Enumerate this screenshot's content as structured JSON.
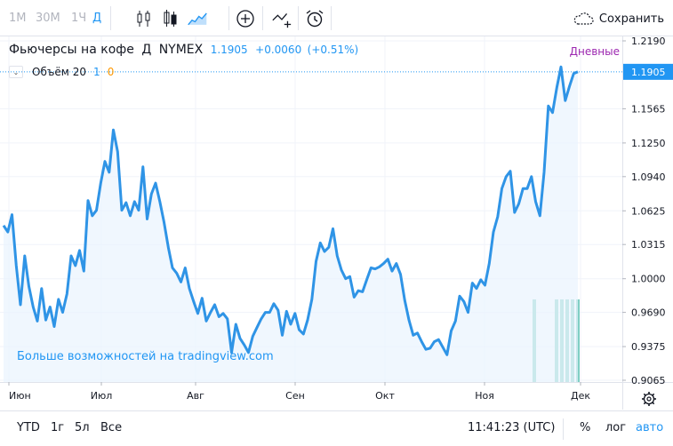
{
  "toolbar": {
    "timeframes": [
      {
        "label": "1М",
        "active": false
      },
      {
        "label": "30М",
        "active": false
      },
      {
        "label": "1Ч",
        "active": false
      },
      {
        "label": "Д",
        "active": true
      }
    ],
    "tools": [
      "candles-icon",
      "bar-style-icon",
      "area-style-icon",
      "add-indicator-icon",
      "compare-icon",
      "alert-icon"
    ],
    "save_label": "Сохранить",
    "save_icon": "cloud-icon"
  },
  "legend": {
    "symbol_name": "Фьючерсы на кофе",
    "interval": "Д",
    "exchange": "NYMEX",
    "last": "1.1905",
    "change": "+0.0060",
    "change_pct": "(+0.51%)"
  },
  "volume_legend": {
    "label": "Объём",
    "length": "20",
    "value_a": "1",
    "value_b": "0"
  },
  "interval_label": "Дневные",
  "promo_text": "Больше возможностей на tradingview.com",
  "colors": {
    "accent": "#2196f3",
    "line": "#2f94e6",
    "area": "#eaf3fd",
    "volume": "#7fcfc4",
    "interval_label": "#9c27b0",
    "orange": "#ff9800"
  },
  "chart_data": {
    "type": "area",
    "series": [
      {
        "values": [
          1.049,
          1.043,
          1.059,
          1.012,
          0.976,
          1.021,
          0.993,
          0.974,
          0.961,
          0.991,
          0.962,
          0.974,
          0.956,
          0.981,
          0.969,
          0.986,
          1.021,
          1.012,
          1.026,
          1.007,
          1.072,
          1.058,
          1.063,
          1.088,
          1.108,
          1.098,
          1.137,
          1.117,
          1.063,
          1.07,
          1.058,
          1.071,
          1.063,
          1.103,
          1.055,
          1.078,
          1.088,
          1.071,
          1.052,
          1.029,
          1.01,
          1.005,
          0.997,
          1.01,
          0.991,
          0.979,
          0.968,
          0.982,
          0.961,
          0.969,
          0.976,
          0.965,
          0.968,
          0.963,
          0.932,
          0.958,
          0.945,
          0.939,
          0.932,
          0.947,
          0.955,
          0.963,
          0.969,
          0.969,
          0.977,
          0.971,
          0.948,
          0.97,
          0.958,
          0.968,
          0.953,
          0.949,
          0.962,
          0.981,
          1.016,
          1.033,
          1.025,
          1.029,
          1.046,
          1.021,
          1.008,
          1.0,
          1.002,
          0.983,
          0.989,
          0.988,
          0.999,
          1.01,
          1.009,
          1.011,
          1.014,
          1.018,
          1.007,
          1.014,
          1.004,
          0.98,
          0.962,
          0.948,
          0.95,
          0.942,
          0.935,
          0.936,
          0.942,
          0.944,
          0.937,
          0.93,
          0.952,
          0.961,
          0.984,
          0.979,
          0.969,
          0.996,
          0.991,
          0.999,
          0.994,
          1.014,
          1.043,
          1.057,
          1.083,
          1.094,
          1.099,
          1.061,
          1.069,
          1.083,
          1.083,
          1.094,
          1.071,
          1.058,
          1.098,
          1.159,
          1.153,
          1.176,
          1.195,
          1.164,
          1.177,
          1.189,
          1.1905
        ]
      }
    ],
    "x_ticks": [
      "Июн",
      "Июл",
      "Авг",
      "Сен",
      "Окт",
      "Ноя",
      "Дек"
    ],
    "y_ticks": [
      "1.2190",
      "1.1565",
      "1.1250",
      "1.0940",
      "1.0625",
      "1.0315",
      "1.0000",
      "0.9690",
      "0.9375",
      "0.9065"
    ],
    "last_price_label": "1.1905",
    "ylim": [
      0.9065,
      1.219
    ],
    "grid": true,
    "volume_bar_count": 6
  },
  "bottom": {
    "ranges": [
      "YTD",
      "1г",
      "5л",
      "Все"
    ],
    "clock": "11:41:23 (UTC)",
    "options": [
      {
        "label": "%",
        "active": false
      },
      {
        "label": "лог",
        "active": false
      },
      {
        "label": "авто",
        "active": true
      }
    ]
  }
}
